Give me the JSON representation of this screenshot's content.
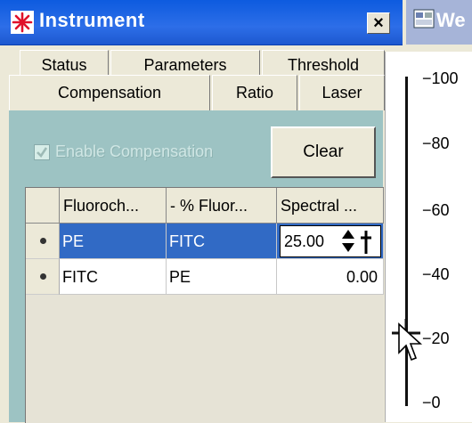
{
  "window": {
    "title": "Instrument",
    "close_label": "×"
  },
  "second_window": {
    "title_fragment": "We"
  },
  "tabs_back": [
    "Status",
    "Parameters",
    "Threshold"
  ],
  "tabs_front": [
    "Compensation",
    "Ratio",
    "Laser"
  ],
  "active_tab": "Compensation",
  "enable_compensation": {
    "label": "Enable Compensation",
    "checked": true,
    "enabled": false
  },
  "clear_button": "Clear",
  "grid": {
    "headers": [
      "Fluoroch...",
      "- % Fluor...",
      "Spectral ..."
    ],
    "rows": [
      {
        "fluorochrome": "PE",
        "minus_fluor": "FITC",
        "spectral": "25.00",
        "selected": true
      },
      {
        "fluorochrome": "FITC",
        "minus_fluor": "PE",
        "spectral": "0.00",
        "selected": false
      }
    ]
  },
  "slider": {
    "ticks": [
      "−100",
      "−80",
      "−60",
      "−40",
      "−20",
      "−0"
    ],
    "value": 25
  },
  "icons": {
    "app": "instrument-star-icon",
    "close": "close-icon",
    "spinner": "spin-arrows-icon",
    "cursor": "mouse-pointer-icon"
  },
  "colors": {
    "titlebar": "#0d5bdf",
    "panel": "#9dc3c3",
    "selection": "#316ac5"
  }
}
